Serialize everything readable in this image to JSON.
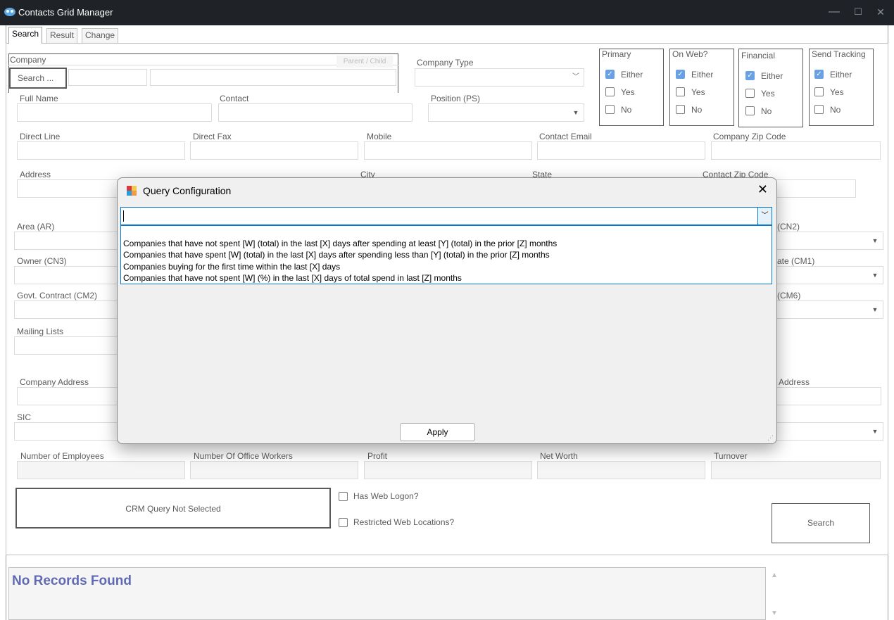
{
  "window": {
    "title": "Contacts Grid Manager",
    "min": "—",
    "max": "☐",
    "close": "✕"
  },
  "tabs": [
    "Search",
    "Result",
    "Change"
  ],
  "company": {
    "group_label": "Company",
    "parent_child_label": "Parent / Child",
    "search_button": "Search ..."
  },
  "fields": {
    "company_type": "Company Type",
    "full_name": "Full Name",
    "contact": "Contact",
    "position": "Position (PS)",
    "direct_line": "Direct Line",
    "direct_fax": "Direct Fax",
    "mobile": "Mobile",
    "contact_email": "Contact Email",
    "company_zip": "Company Zip Code",
    "address": "Address",
    "city": "City",
    "state": "State",
    "contact_zip": "Contact Zip Code",
    "area": "Area (AR)",
    "cn2": "(CN2)",
    "owner": "Owner (CN3)",
    "cm1": "ate (CM1)",
    "govt_contract": "Govt. Contract (CM2)",
    "cm6": "(CM6)",
    "mailing_lists": "Mailing Lists",
    "company_address": "Company Address",
    "right_address": "Address",
    "sic": "SIC",
    "num_employees": "Number of Employees",
    "num_office_workers": "Number Of Office Workers",
    "profit": "Profit",
    "net_worth": "Net Worth",
    "turnover": "Turnover"
  },
  "filters": [
    {
      "title": "Primary",
      "options": [
        "Either",
        "Yes",
        "No"
      ],
      "checked": 0
    },
    {
      "title": "On Web?",
      "options": [
        "Either",
        "Yes",
        "No"
      ],
      "checked": 0
    },
    {
      "title": "Financial",
      "options": [
        "Either",
        "Yes",
        "No"
      ],
      "checked": 0
    },
    {
      "title": "Send Tracking",
      "options": [
        "Either",
        "Yes",
        "No"
      ],
      "checked": 0
    }
  ],
  "crm_query": "CRM Query Not Selected",
  "has_web_logon": "Has Web Logon?",
  "restricted_web": "Restricted Web Locations?",
  "search_button": "Search",
  "results_text": "No Records Found",
  "modal": {
    "title": "Query Configuration",
    "close": "✕",
    "combo_value": "",
    "options": [
      "Companies that have not spent [W] (total) in the last [X] days after spending at least [Y] (total) in the prior [Z] months",
      "Companies that have spent [W] (total) in the last [X] days after spending less than [Y] (total) in the prior [Z] months",
      "Companies buying for the first time within the last [X] days",
      "Companies that have not spent [W] (%) in the last [X] days of total spend in last [Z] months"
    ],
    "apply": "Apply"
  }
}
